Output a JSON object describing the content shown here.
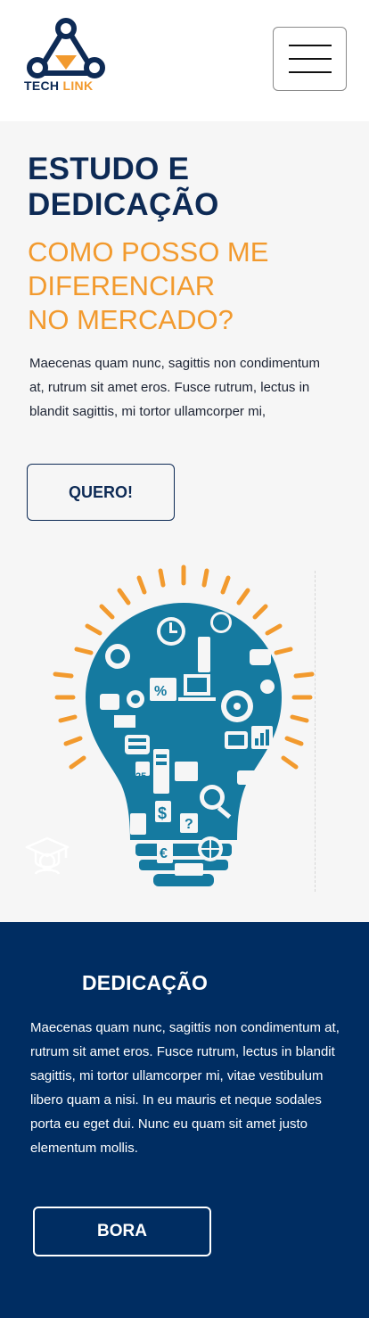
{
  "header": {
    "logo_word_1": "TECH",
    "logo_word_2": "LINK",
    "menu_icon": "hamburger-menu-icon"
  },
  "hero": {
    "title": "ESTUDO E DEDICAÇÃO",
    "subtitle_lines": [
      "COMO POSSO ME",
      "DIFERENCIAR",
      "NO MERCADO?"
    ],
    "body": "Maecenas quam nunc, sagittis non condimentum at, rutrum sit amet eros. Fusce rutrum, lectus in blandit sagittis, mi tortor ullamcorper mi,",
    "cta_label": "QUERO!",
    "illustration_icon": "lightbulb-icons-illustration",
    "badge_icon": "graduation-cap-icon"
  },
  "dedicacao": {
    "title": "DEDICAÇÃO",
    "body": "Maecenas quam nunc, sagittis non condimentum at, rutrum sit amet eros. Fusce rutrum, lectus in blandit sagittis, mi tortor ullamcorper mi, vitae vestibulum libero quam a nisi. In eu mauris et neque sodales porta eu eget dui. Nunc eu quam sit amet justo elementum mollis.",
    "cta_label": "BORA"
  },
  "colors": {
    "navy": "#0d2a55",
    "orange": "#f29a2e",
    "section_blue": "#002d62",
    "teal": "#1a7fa3"
  }
}
